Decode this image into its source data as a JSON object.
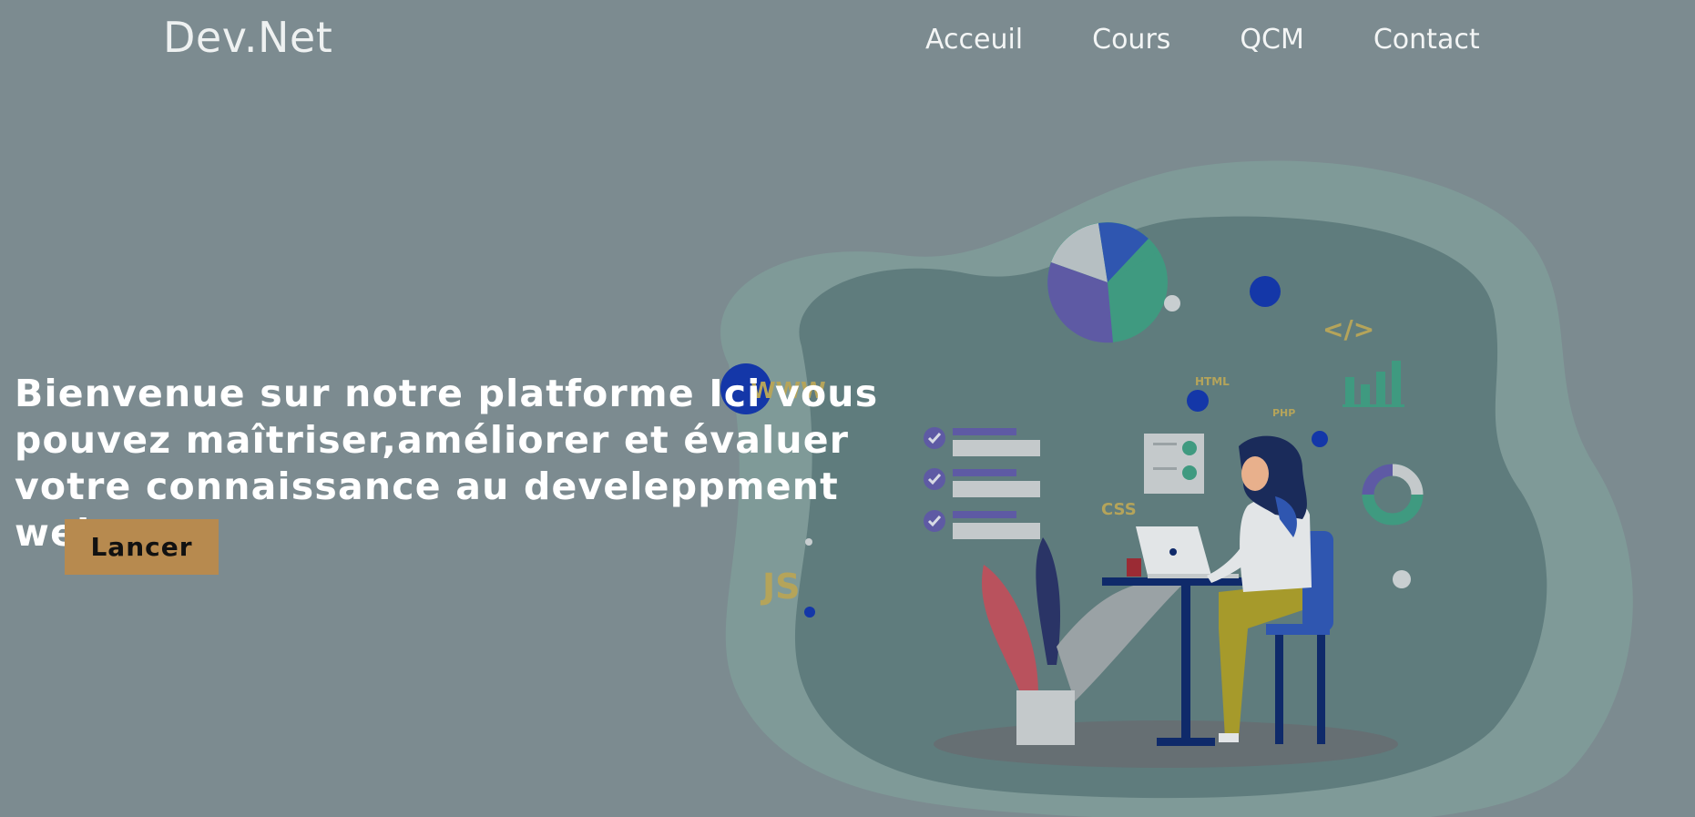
{
  "header": {
    "brand": "Dev.Net",
    "nav": [
      {
        "label": "Acceuil"
      },
      {
        "label": "Cours"
      },
      {
        "label": "QCM"
      },
      {
        "label": "Contact"
      }
    ]
  },
  "hero": {
    "headline": "Bienvenue sur notre platforme Ici vous pouvez maîtriser,améliorer et évaluer votre connaissance au develeppment web",
    "cta_label": "Lancer",
    "illustration": {
      "labels": {
        "www": "WWW",
        "code": "</>",
        "html": "HTML",
        "php": "PHP",
        "css": "CSS",
        "js": "JS"
      }
    }
  },
  "colors": {
    "overlay": "#7c8b90",
    "blob_outer": "#7f9b98",
    "blob_inner": "#5f7c7d",
    "cta": "#b78a4f",
    "accent_yellow": "#b5a45a",
    "accent_blue": "#1437a8",
    "accent_purple": "#5e5aa4",
    "accent_teal": "#3f9a80",
    "accent_red": "#b9525d"
  }
}
